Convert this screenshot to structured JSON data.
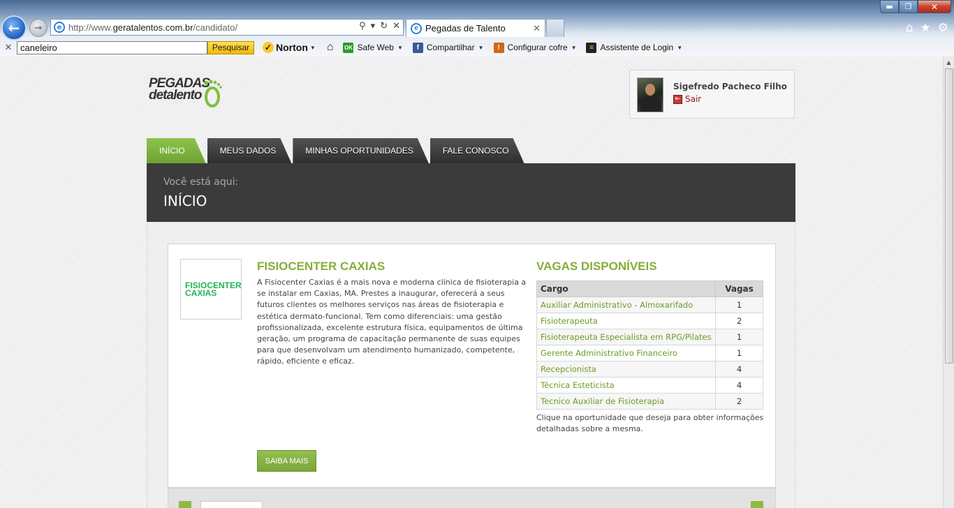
{
  "browser": {
    "url_prefix": "http://www.",
    "url_domain": "geratalentos.com.br",
    "url_path": "/candidato/",
    "tab_title": "Pegadas de Talento",
    "search_value": "caneleiro",
    "search_button": "Pesquisar",
    "toolbar": {
      "norton": "Norton",
      "safe_web": "Safe Web",
      "share": "Compartilhar",
      "vault": "Configurar cofre",
      "login_assistant": "Assistente de Login"
    }
  },
  "site": {
    "logo_line1": "PEGADAS",
    "logo_line2": "detalento",
    "user_name": "Sigefredo Pacheco Filho",
    "logout": "Sair",
    "nav": [
      {
        "label": "INÍCIO",
        "active": true
      },
      {
        "label": "MEUS DADOS",
        "active": false
      },
      {
        "label": "MINHAS OPORTUNIDADES",
        "active": false
      },
      {
        "label": "FALE CONOSCO",
        "active": false
      }
    ],
    "breadcrumb_label": "Você está aqui:",
    "breadcrumb_title": "INÍCIO"
  },
  "company": {
    "logo_line1": "FISIOCENTER",
    "logo_line2": "CAXIAS",
    "title": "FISIOCENTER CAXIAS",
    "description": "A Fisiocenter Caxias é a mais nova e moderna clínica de fisioterapia a se instalar em Caxias, MA. Prestes a inaugurar, oferecerá a seus futuros clientes os melhores serviços nas áreas de fisioterapia e estética dermato-funcional. Tem como diferenciais: uma gestão profissionalizada, excelente estrutura física, equipamentos de última geração, um programa de capacitação permanente de suas equipes para que desenvolvam um atendimento humanizado, competente, rápido, eficiente e eficaz.",
    "more_button": "SAIBA MAIS"
  },
  "vagas": {
    "title": "VAGAS DISPONÍVEIS",
    "col_cargo": "Cargo",
    "col_vagas": "Vagas",
    "rows": [
      {
        "cargo": "Auxiliar Administrativo - Almoxarifado",
        "vagas": "1"
      },
      {
        "cargo": "Fisioterapeuta",
        "vagas": "2"
      },
      {
        "cargo": "Fisioterapeuta Especialista em RPG/Pilates",
        "vagas": "1"
      },
      {
        "cargo": "Gerente Administrativo Financeiro",
        "vagas": "1"
      },
      {
        "cargo": "Recepcionista",
        "vagas": "4"
      },
      {
        "cargo": "Técnica Esteticista",
        "vagas": "4"
      },
      {
        "cargo": "Tecnico Auxiliar de Fisioterapia",
        "vagas": "2"
      }
    ],
    "note": "Clique na oportunidade que deseja para obter informações detalhadas sobre a mesma."
  },
  "colors": {
    "accent_green": "#86ad3b",
    "dark_bar": "#3b3b3b",
    "company_green": "#21b35a"
  }
}
